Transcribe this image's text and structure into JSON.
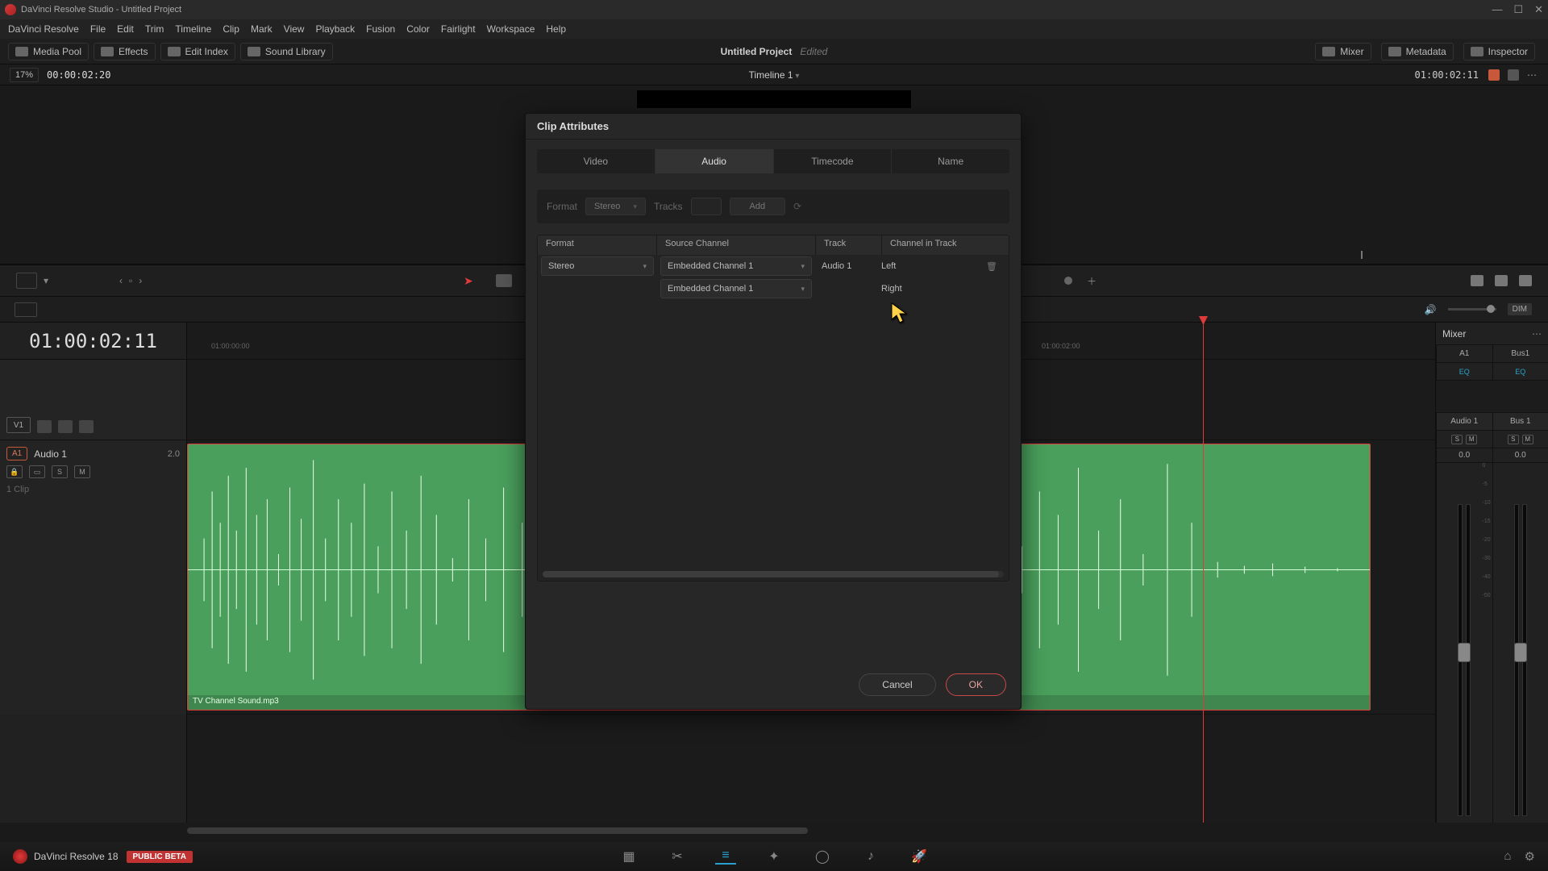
{
  "window_title": "DaVinci Resolve Studio - Untitled Project",
  "menu": [
    "DaVinci Resolve",
    "File",
    "Edit",
    "Trim",
    "Timeline",
    "Clip",
    "Mark",
    "View",
    "Playback",
    "Fusion",
    "Color",
    "Fairlight",
    "Workspace",
    "Help"
  ],
  "toolbar": {
    "media_pool": "Media Pool",
    "effects": "Effects",
    "edit_index": "Edit Index",
    "sound_library": "Sound Library",
    "mixer": "Mixer",
    "metadata": "Metadata",
    "inspector": "Inspector"
  },
  "project": {
    "title": "Untitled Project",
    "status": "Edited"
  },
  "subheader": {
    "zoom": "17%",
    "source_tc": "00:00:02:20",
    "timeline_name": "Timeline 1",
    "rec_tc": "01:00:02:11"
  },
  "tl2": {
    "dim": "DIM"
  },
  "timeline": {
    "big_tc": "01:00:02:11",
    "ruler_label_start": "01:00:00:00",
    "ruler_label_2s": "01:00:02:00",
    "v1_label": "V1",
    "a1_badge": "A1",
    "a1_name": "Audio 1",
    "a1_ch": "2.0",
    "s_label": "S",
    "m_label": "M",
    "clip_count": "1 Clip",
    "clip_name": "TV Channel Sound.mp3"
  },
  "mixer": {
    "title": "Mixer",
    "ch1": "A1",
    "ch2": "Bus1",
    "eq": "EQ",
    "name1": "Audio 1",
    "name2": "Bus 1",
    "s": "S",
    "m": "M",
    "db": "0.0",
    "scale": [
      "0",
      "-5",
      "-10",
      "-15",
      "-20",
      "-30",
      "-40",
      "-50"
    ]
  },
  "dialog": {
    "title": "Clip Attributes",
    "tabs": {
      "video": "Video",
      "audio": "Audio",
      "timecode": "Timecode",
      "name": "Name"
    },
    "format_label": "Format",
    "format_value": "Stereo",
    "tracks_label": "Tracks",
    "add_btn": "Add",
    "columns": {
      "fmt": "Format",
      "src": "Source Channel",
      "trk": "Track",
      "cit": "Channel in Track"
    },
    "row1": {
      "fmt": "Stereo",
      "src": "Embedded Channel 1",
      "trk": "Audio 1",
      "cit": "Left"
    },
    "row2": {
      "src": "Embedded Channel 1",
      "cit": "Right"
    },
    "cancel": "Cancel",
    "ok": "OK"
  },
  "bottom": {
    "app_name": "DaVinci Resolve 18",
    "beta": "PUBLIC BETA"
  }
}
